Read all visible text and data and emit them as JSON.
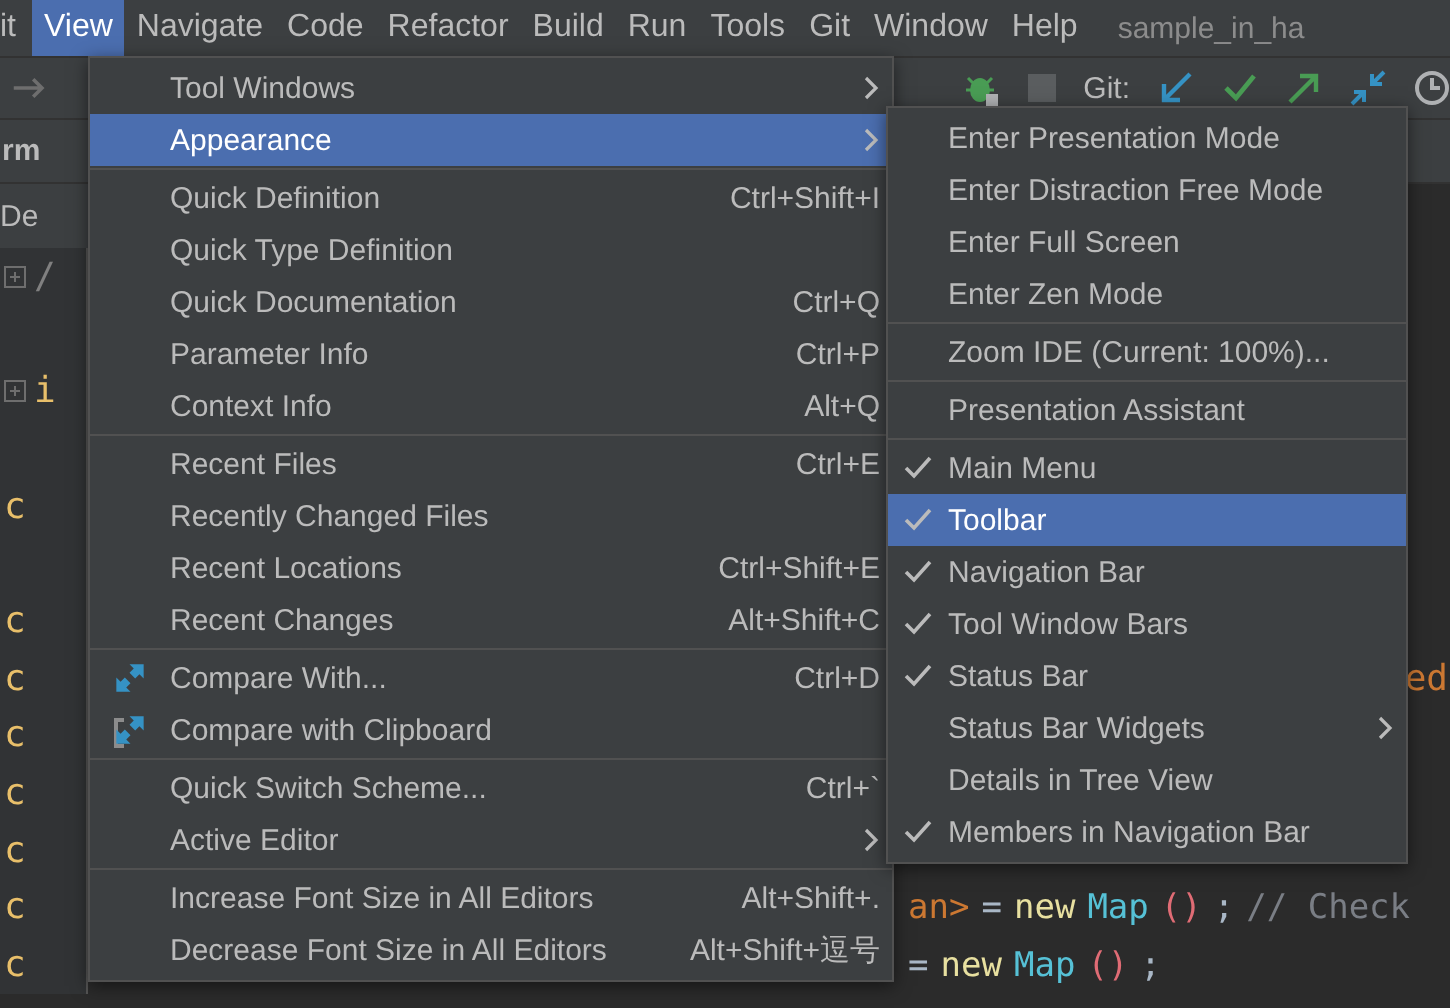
{
  "menu_bar": {
    "items": [
      {
        "label": "it",
        "selected": false
      },
      {
        "label": "View",
        "selected": true
      },
      {
        "label": "Navigate",
        "selected": false
      },
      {
        "label": "Code",
        "selected": false
      },
      {
        "label": "Refactor",
        "selected": false
      },
      {
        "label": "Build",
        "selected": false
      },
      {
        "label": "Run",
        "selected": false
      },
      {
        "label": "Tools",
        "selected": false
      },
      {
        "label": "Git",
        "selected": false
      },
      {
        "label": "Window",
        "selected": false
      },
      {
        "label": "Help",
        "selected": false
      }
    ],
    "project_title": "sample_in_ha"
  },
  "toolbar": {
    "git_label": "Git:"
  },
  "left_panel": {
    "header": "rm",
    "item": "De"
  },
  "editor": {
    "lines": [
      {
        "gutter": "/",
        "kind": "comment",
        "fold": true
      },
      {
        "kind": "blank"
      },
      {
        "gutter": "i",
        "kind": "keyword",
        "fold": true
      },
      {
        "kind": "blank"
      },
      {
        "gutter": "c",
        "kind": "keyword"
      },
      {
        "kind": "blank"
      },
      {
        "gutter": "c",
        "kind": "keyword"
      },
      {
        "gutter": "c",
        "kind": "keyword",
        "edge_code": "ed"
      },
      {
        "gutter": "c",
        "kind": "keyword"
      },
      {
        "gutter": "c",
        "kind": "keyword"
      },
      {
        "gutter": "c",
        "kind": "keyword"
      },
      {
        "gutter": "c",
        "kind": "keyword",
        "code": [
          {
            "text": "an>",
            "kind": "generic"
          },
          {
            "text": "=",
            "kind": "plain"
          },
          {
            "text": "new",
            "kind": "keyword"
          },
          {
            "text": "Map",
            "kind": "class"
          },
          {
            "text": "()",
            "kind": "paren"
          },
          {
            "text": ";",
            "kind": "plain"
          },
          {
            "text": "// Check",
            "kind": "comment"
          }
        ]
      },
      {
        "gutter": "c",
        "kind": "keyword",
        "code": [
          {
            "text": "=",
            "kind": "plain"
          },
          {
            "text": "new",
            "kind": "keyword"
          },
          {
            "text": "Map",
            "kind": "class"
          },
          {
            "text": "()",
            "kind": "paren"
          },
          {
            "text": ";",
            "kind": "plain"
          }
        ]
      }
    ]
  },
  "view_menu": {
    "groups": [
      [
        {
          "label": "Tool Windows",
          "submenu": true,
          "selected": false
        },
        {
          "label": "Appearance",
          "submenu": true,
          "selected": true
        }
      ],
      [
        {
          "label": "Quick Definition",
          "shortcut": "Ctrl+Shift+I",
          "selected": false
        },
        {
          "label": "Quick Type Definition",
          "selected": false
        },
        {
          "label": "Quick Documentation",
          "shortcut": "Ctrl+Q",
          "selected": false
        },
        {
          "label": "Parameter Info",
          "shortcut": "Ctrl+P",
          "selected": false
        },
        {
          "label": "Context Info",
          "shortcut": "Alt+Q",
          "selected": false
        }
      ],
      [
        {
          "label": "Recent Files",
          "shortcut": "Ctrl+E",
          "selected": false
        },
        {
          "label": "Recently Changed Files",
          "selected": false
        },
        {
          "label": "Recent Locations",
          "shortcut": "Ctrl+Shift+E",
          "selected": false
        },
        {
          "label": "Recent Changes",
          "shortcut": "Alt+Shift+C",
          "selected": false
        }
      ],
      [
        {
          "label": "Compare With...",
          "shortcut": "Ctrl+D",
          "kind": "compare",
          "selected": false
        },
        {
          "label": "Compare with Clipboard",
          "kind": "clipboard",
          "selected": false
        }
      ],
      [
        {
          "label": "Quick Switch Scheme...",
          "shortcut": "Ctrl+`",
          "selected": false
        },
        {
          "label": "Active Editor",
          "submenu": true,
          "selected": false
        }
      ],
      [
        {
          "label": "Increase Font Size in All Editors",
          "shortcut": "Alt+Shift+.",
          "selected": false
        },
        {
          "label": "Decrease Font Size in All Editors",
          "shortcut": "Alt+Shift+逗号",
          "selected": false
        }
      ]
    ]
  },
  "appearance_menu": {
    "groups": [
      [
        {
          "label": "Enter Presentation Mode",
          "checked": false,
          "selected": false
        },
        {
          "label": "Enter Distraction Free Mode",
          "checked": false,
          "selected": false
        },
        {
          "label": "Enter Full Screen",
          "checked": false,
          "selected": false
        },
        {
          "label": "Enter Zen Mode",
          "checked": false,
          "selected": false
        }
      ],
      [
        {
          "label": "Zoom IDE (Current: 100%)...",
          "checked": false,
          "selected": false
        }
      ],
      [
        {
          "label": "Presentation Assistant",
          "checked": false,
          "selected": false
        }
      ],
      [
        {
          "label": "Main Menu",
          "checked": true,
          "selected": false
        },
        {
          "label": "Toolbar",
          "checked": true,
          "selected": true
        },
        {
          "label": "Navigation Bar",
          "checked": true,
          "selected": false
        },
        {
          "label": "Tool Window Bars",
          "checked": true,
          "selected": false
        },
        {
          "label": "Status Bar",
          "checked": true,
          "selected": false
        },
        {
          "label": "Status Bar Widgets",
          "checked": false,
          "submenu": true,
          "selected": false
        },
        {
          "label": "Details in Tree View",
          "checked": false,
          "selected": false
        },
        {
          "label": "Members in Navigation Bar",
          "checked": true,
          "selected": false
        }
      ]
    ]
  }
}
